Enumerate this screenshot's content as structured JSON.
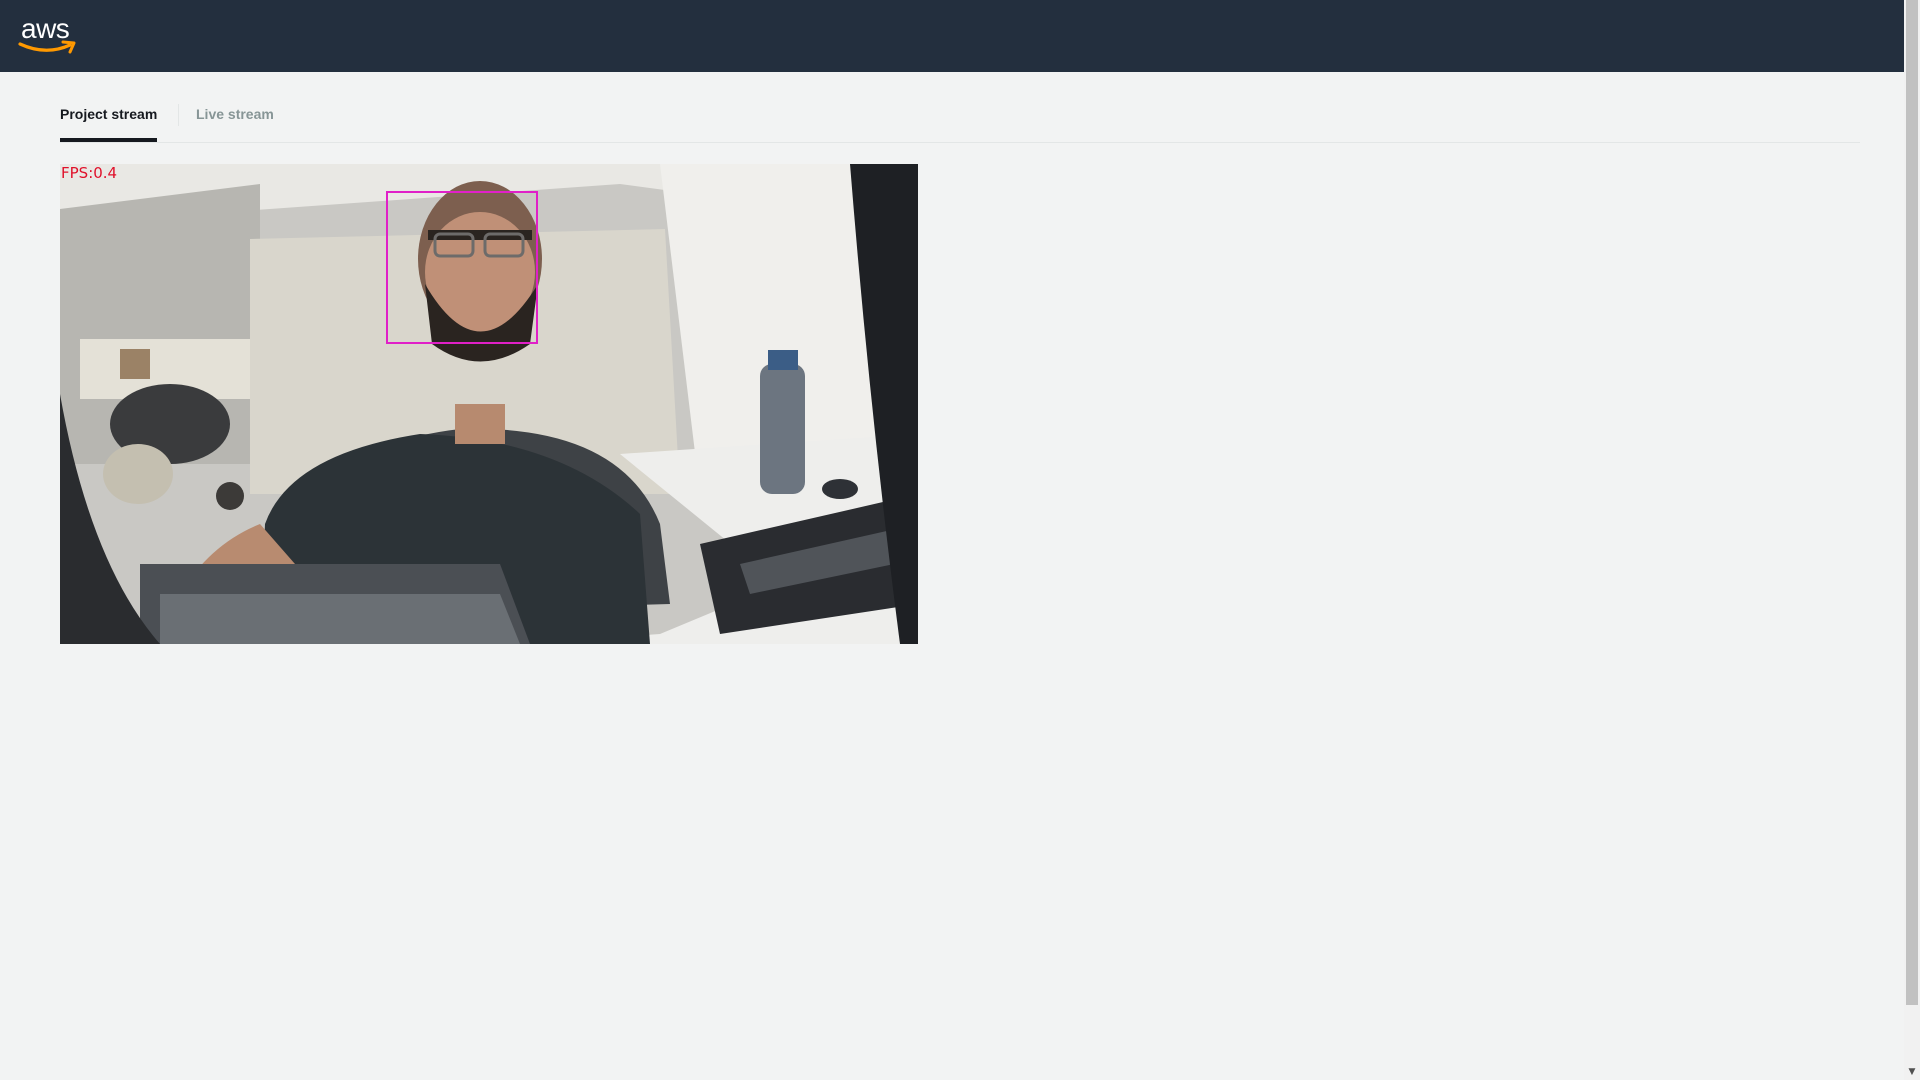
{
  "header": {
    "logo_text": "aws",
    "background": "#232f3e",
    "accent": "#ff9900"
  },
  "tabs": [
    {
      "label": "Project stream",
      "active": true
    },
    {
      "label": "Live stream",
      "active": false
    }
  ],
  "stream": {
    "fps_label": "FPS:0.4",
    "detection_box_color": "#e020c8",
    "fps_color": "#e0102a"
  },
  "scrollbar": {
    "down_arrow": "▼"
  }
}
